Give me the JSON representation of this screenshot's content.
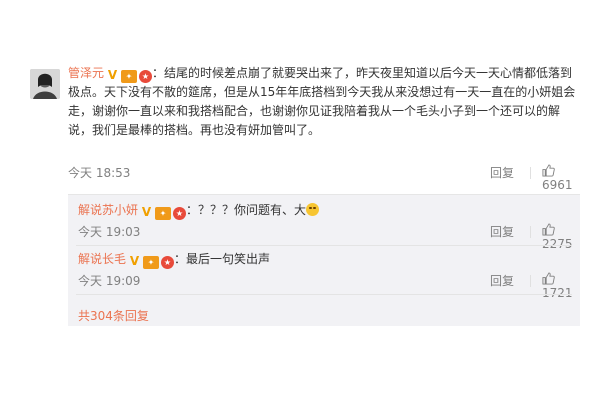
{
  "main_comment": {
    "username": "管泽元",
    "text": "：结尾的时候差点崩了就要哭出来了，昨天夜里知道以后今天一天心情都低落到极点。天下没有不散的筵席，但是从15年年底搭档到今天我从来没想过有一天一直在的小妍姐会走，谢谢你一直以来和我搭档配合，也谢谢你见证我陪着我从一个毛头小子到一个还可以的解说，我们是最棒的搭档。再也没有妍加管叫了。",
    "time": "今天 18:53",
    "reply_label": "回复",
    "likes": "6961"
  },
  "replies": [
    {
      "username": "解说苏小妍",
      "text": "：？？？你问题有、大",
      "time": "今天 19:03",
      "reply_label": "回复",
      "likes": "2275"
    },
    {
      "username": "解说长毛",
      "text": "：最后一句笑出声",
      "time": "今天 19:09",
      "reply_label": "回复",
      "likes": "1721"
    }
  ],
  "more_replies": "共304条回复",
  "icons": {
    "verified": "verified-v-icon",
    "level": "level-badge-icon",
    "award": "award-badge-icon",
    "like": "thumbs-up-icon",
    "emoji": "laugh-emoji-icon"
  },
  "colors": {
    "username": "#eb7350",
    "meta": "#808080",
    "reply_bg": "#f2f2f5"
  }
}
